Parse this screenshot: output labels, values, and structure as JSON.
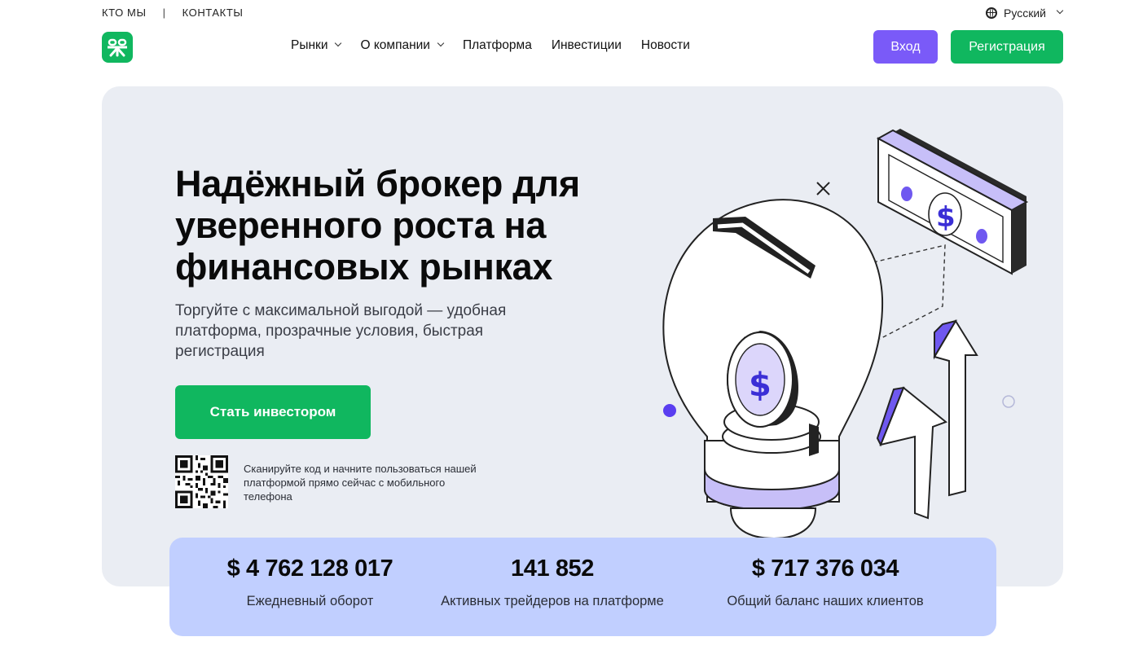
{
  "topbar": {
    "about": "КТО МЫ",
    "contacts": "КОНТАКТЫ",
    "language": "Русский"
  },
  "nav": {
    "markets": "Рынки",
    "company": "О компании",
    "platform": "Платформа",
    "investments": "Инвестиции",
    "news": "Новости"
  },
  "auth": {
    "login": "Вход",
    "register": "Регистрация"
  },
  "hero": {
    "title": "Надёжный брокер для уверенного роста на финансовых рынках",
    "subtitle": "Торгуйте с максимальной выгодой — удобная платформа, прозрачные условия, быстрая регистрация",
    "cta": "Стать инвестором",
    "qr_text": "Сканируйте код и начните пользоваться нашей платформой прямо сейчас с мобильного телефона"
  },
  "stats": [
    {
      "value": "$ 4 762 128 017",
      "label": "Ежедневный оборот"
    },
    {
      "value": "141 852",
      "label": "Активных трейдеров на платформе"
    },
    {
      "value": "$ 717 376 034",
      "label": "Общий баланс наших клиентов"
    }
  ],
  "colors": {
    "brand_green": "#10b75f",
    "accent_purple": "#7a5af8",
    "hero_bg": "#eaedf3",
    "stats_bg": "#c1cfff"
  },
  "icons": [
    "globe-icon",
    "chevron-down-icon",
    "logo-icon",
    "qr-code",
    "dollar-icon"
  ]
}
